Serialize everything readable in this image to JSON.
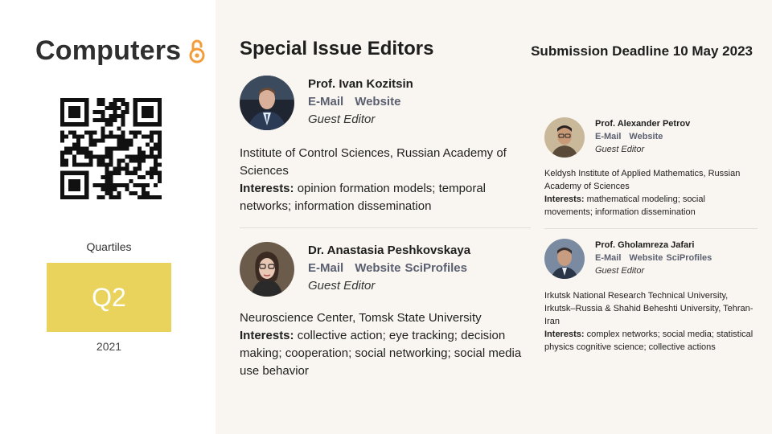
{
  "journal": {
    "name": "Computers",
    "logo_icon": "open-access-icon",
    "accent": "#f39c3c"
  },
  "quartile": {
    "label": "Quartiles",
    "value": "Q2",
    "year": "2021",
    "box_color": "#e9d35c"
  },
  "header": {
    "title": "Special Issue Editors",
    "deadline": "Submission Deadline 10 May 2023"
  },
  "editors": [
    {
      "name": "Prof. Ivan Kozitsin",
      "links": [
        "E-Mail",
        "Website"
      ],
      "role": "Guest Editor",
      "affiliation": "Institute of Control Sciences, Russian Academy of Sciences",
      "interests_label": "Interests:",
      "interests": "opinion formation models; temporal networks; information dissemination"
    },
    {
      "name": "Dr. Anastasia Peshkovskaya",
      "links": [
        "E-Mail",
        "Website",
        "SciProfiles"
      ],
      "role": "Guest Editor",
      "affiliation": "Neuroscience Center, Tomsk State University",
      "interests_label": "Interests:",
      "interests": "collective action; eye tracking; decision making; cooperation; social networking; social media use behavior"
    },
    {
      "name": "Prof. Alexander Petrov",
      "links": [
        "E-Mail",
        "Website"
      ],
      "role": "Guest Editor",
      "affiliation": "Keldysh Institute of Applied Mathematics, Russian Academy of Sciences",
      "interests_label": "Interests:",
      "interests": "mathematical modeling; social movements; information dissemination"
    },
    {
      "name": "Prof. Gholamreza Jafari",
      "links": [
        "E-Mail",
        "Website",
        "SciProfiles"
      ],
      "role": "Guest Editor",
      "affiliation": "Irkutsk National Research Technical University, Irkutsk–Russia & Shahid Beheshti University, Tehran-Iran",
      "interests_label": "Interests:",
      "interests": "complex networks; social media; statistical physics cognitive science; collective actions"
    }
  ]
}
